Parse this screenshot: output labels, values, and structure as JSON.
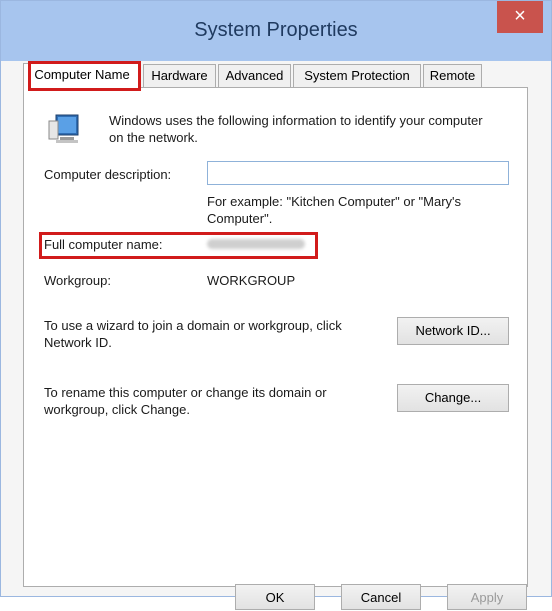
{
  "window": {
    "title": "System Properties",
    "close_label": "×"
  },
  "tabs": [
    {
      "label": "Computer Name"
    },
    {
      "label": "Hardware"
    },
    {
      "label": "Advanced"
    },
    {
      "label": "System Protection"
    },
    {
      "label": "Remote"
    }
  ],
  "computer_name": {
    "intro_line1": "Windows uses the following information to identify your computer",
    "intro_line2": "on the network.",
    "description_label": "Computer description:",
    "description_value": "",
    "example_line1": "For example: \"Kitchen Computer\" or \"Mary's",
    "example_line2": "Computer\".",
    "full_name_label": "Full computer name:",
    "workgroup_label": "Workgroup:",
    "workgroup_value": "WORKGROUP",
    "wizard_line1": "To use a wizard to join a domain or workgroup, click",
    "wizard_line2": "Network ID.",
    "network_id_button": "Network ID...",
    "rename_line1": "To rename this computer or change its domain or",
    "rename_line2": "workgroup, click Change.",
    "change_button": "Change..."
  },
  "footer": {
    "ok": "OK",
    "cancel": "Cancel",
    "apply": "Apply"
  },
  "icons": {
    "computer": "computer-icon",
    "close": "close-icon"
  },
  "colors": {
    "titlebar": "#a7c5ee",
    "close_button": "#c9534d",
    "highlight": "#d11b1b"
  }
}
